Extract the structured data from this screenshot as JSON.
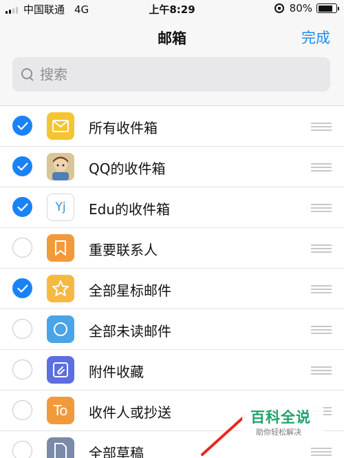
{
  "status_bar": {
    "carrier": "中国联通",
    "network": "4G",
    "time": "上午8:29",
    "battery": "80%",
    "battery_level": 0.8,
    "signal_bars_filled": 2
  },
  "nav": {
    "title": "邮箱",
    "done_label": "完成"
  },
  "search": {
    "placeholder": "搜索"
  },
  "colors": {
    "accent": "#1a8cf0",
    "check_on": "#1a82f7"
  },
  "mailboxes": [
    {
      "label": "所有收件箱",
      "checked": true,
      "icon": "envelope-icon",
      "icon_color": "#f5c431"
    },
    {
      "label": "QQ的收件箱",
      "checked": true,
      "icon": "avatar-icon",
      "icon_color": "#c9b28a"
    },
    {
      "label": "Edu的收件箱",
      "checked": true,
      "icon": "yj-text-icon",
      "icon_text": "Yj",
      "icon_color": "#ffffff"
    },
    {
      "label": "重要联系人",
      "checked": false,
      "icon": "bookmark-icon",
      "icon_color": "#f29a3b"
    },
    {
      "label": "全部星标邮件",
      "checked": true,
      "icon": "star-icon",
      "icon_color": "#f5b942"
    },
    {
      "label": "全部未读邮件",
      "checked": false,
      "icon": "circle-icon",
      "icon_color": "#4aa4e8"
    },
    {
      "label": "附件收藏",
      "checked": false,
      "icon": "paperclip-icon",
      "icon_color": "#5c6fe0"
    },
    {
      "label": "收件人或抄送",
      "checked": false,
      "icon": "to-text-icon",
      "icon_text": "To",
      "icon_color": "#f29a3b"
    },
    {
      "label": "全部草稿",
      "checked": false,
      "icon": "draft-icon",
      "icon_color": "#7b8aa6"
    }
  ],
  "watermark": {
    "title": "百科全说",
    "subtitle": "助你轻松解决"
  }
}
